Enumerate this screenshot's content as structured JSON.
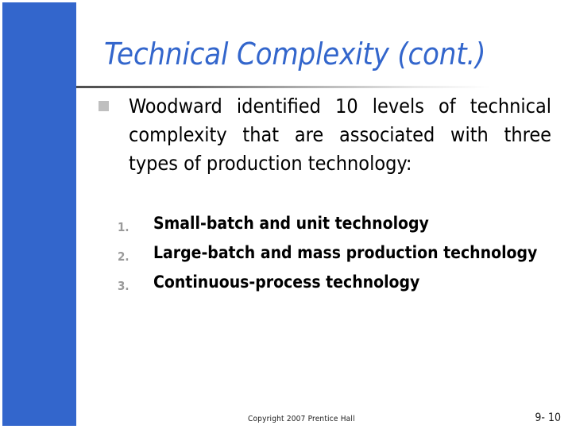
{
  "slide": {
    "title": "Technical Complexity (cont.)",
    "accent_color": "#3366cc",
    "bullet_color": "#bfbfbf",
    "number_color": "#9a9a9a",
    "body_color": "#000000",
    "background_color": "#ffffff"
  },
  "body": {
    "bullet_icon": "square-bullet",
    "paragraph": "Woodward identified 10 levels of technical complexity that are associated with three types of production technology:"
  },
  "numbered_list": [
    {
      "number": "1.",
      "text": "Small-batch and unit technology"
    },
    {
      "number": "2.",
      "text": "Large-batch and mass production technology"
    },
    {
      "number": "3.",
      "text": "Continuous-process technology"
    }
  ],
  "footer": {
    "copyright": "Copyright 2007 Prentice Hall",
    "page_number": "9- 10"
  }
}
